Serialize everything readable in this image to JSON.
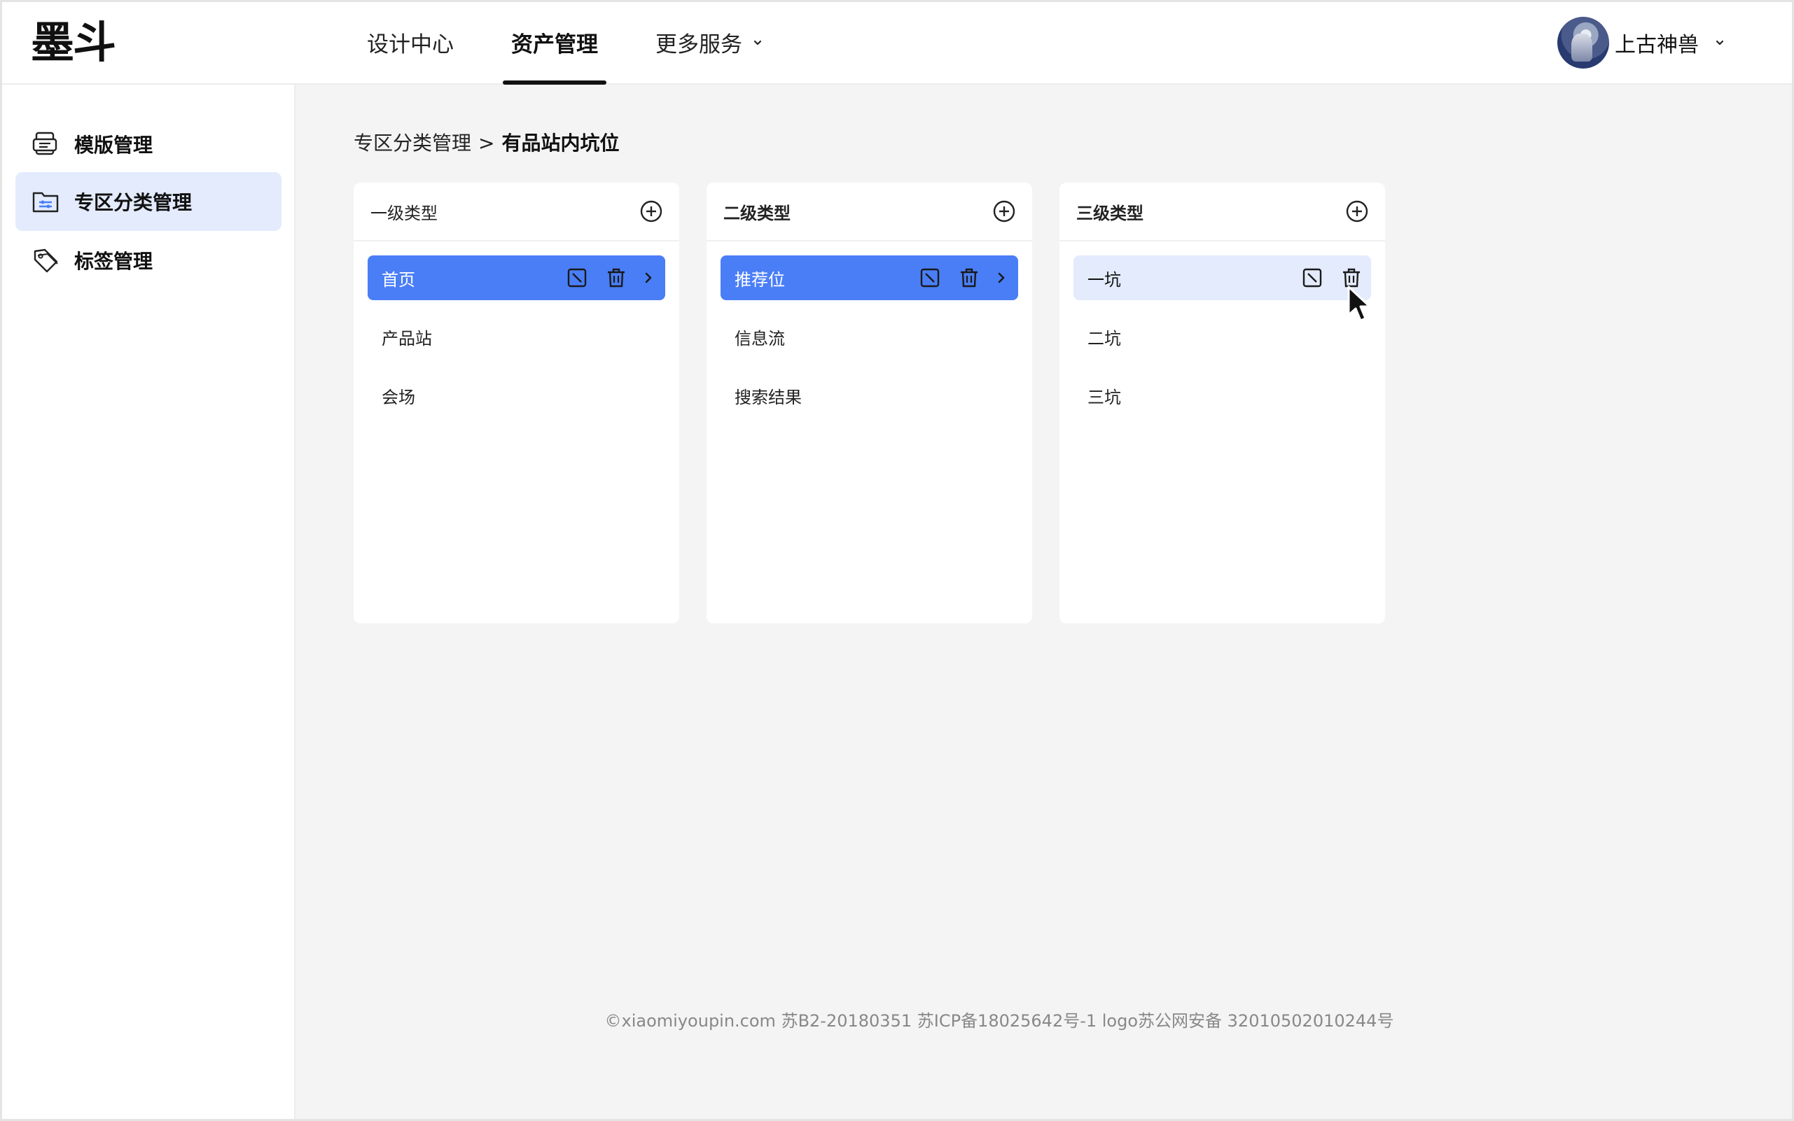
{
  "header": {
    "logo": "墨斗",
    "nav": [
      {
        "label": "设计中心",
        "active": false
      },
      {
        "label": "资产管理",
        "active": true
      },
      {
        "label": "更多服务",
        "active": false
      }
    ],
    "user": {
      "name": "上古神兽"
    }
  },
  "sidebar": {
    "items": [
      {
        "label": "模版管理",
        "icon": "template-icon"
      },
      {
        "label": "专区分类管理",
        "icon": "folder-settings-icon",
        "active": true
      },
      {
        "label": "标签管理",
        "icon": "tag-icon"
      }
    ]
  },
  "breadcrumb": {
    "parent": "专区分类管理",
    "separator": ">",
    "current": "有品站内坑位"
  },
  "columns": [
    {
      "title": "一级类型",
      "items": [
        "首页",
        "产品站",
        "会场"
      ]
    },
    {
      "title": "二级类型",
      "items": [
        "推荐位",
        "信息流",
        "搜索结果"
      ]
    },
    {
      "title": "三级类型",
      "items": [
        "一坑",
        "二坑",
        "三坑"
      ]
    }
  ],
  "colors": {
    "accent": "#4a7ef7",
    "selected_light": "#e3ebfd",
    "background": "#f4f4f4"
  },
  "footer": {
    "text": "©xiaomiyoupin.com 苏B2-20180351 苏ICP备18025642号-1 logo苏公网安备 32010502010244号"
  }
}
